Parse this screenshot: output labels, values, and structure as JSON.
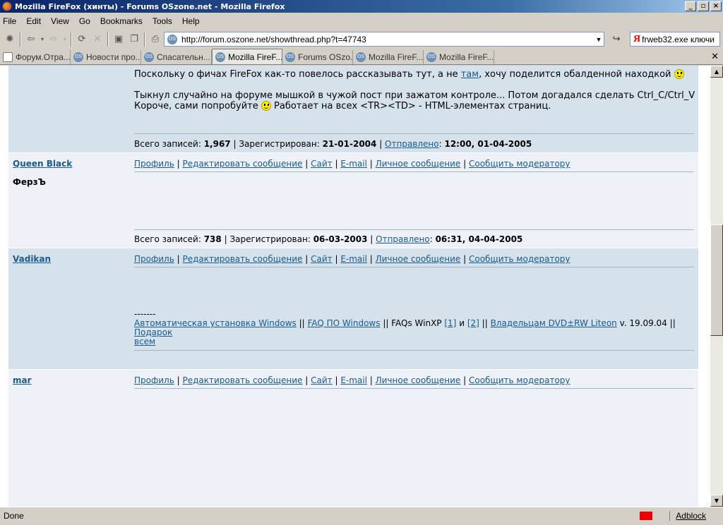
{
  "window": {
    "title": "Mozilla FireFox (хинты) - Forums OSzone.net - Mozilla Firefox"
  },
  "menu": [
    "File",
    "Edit",
    "View",
    "Go",
    "Bookmarks",
    "Tools",
    "Help"
  ],
  "address": {
    "url": "http://forum.oszone.net/showthread.php?t=47743",
    "search_value": "frweb32.exe ключи",
    "search_logo": "Я"
  },
  "tabs": [
    {
      "label": "Форум.Отра...",
      "icon": "page-icon"
    },
    {
      "label": "Новости про...",
      "icon": "os-icon"
    },
    {
      "label": "Спасательн...",
      "icon": "os-icon"
    },
    {
      "label": "Mozilla FireF...",
      "icon": "os-icon",
      "active": true
    },
    {
      "label": "Forums OSzo...",
      "icon": "os-icon"
    },
    {
      "label": "Mozilla FireF...",
      "icon": "os-icon"
    },
    {
      "label": "Mozilla FireF...",
      "icon": "os-icon"
    }
  ],
  "post1": {
    "line1_pre": "Поскольку о фичах FireFox как-то повелось рассказывать тут, а не ",
    "line1_link": "там",
    "line1_post": ", хочу поделится обалденной находкой",
    "line2": "Тыкнул случайно на форуме мышкой в чужой пост при зажатом контроле... Потом догадался сделать Ctrl_C/Ctrl_V",
    "line3_pre": "Короче, сами попробуйте",
    "line3_post": "Работает на всех <TR><TD> - HTML-элементах страниц.",
    "meta": {
      "posts_label": "Всего записей:",
      "posts": "1,967",
      "reg_label": "Зарегистрирован:",
      "reg": "21-01-2004",
      "sent_label": "Отправлено",
      "sent": "12:00, 01-04-2005"
    }
  },
  "links": {
    "profile": "Профиль",
    "edit": "Редактировать сообщение",
    "site": "Сайт",
    "email": "E-mail",
    "pm": "Личное сообщение",
    "report": "Сообщить модератору"
  },
  "post2": {
    "user": "Queen Black",
    "user_title": "ФерзЪ",
    "meta": {
      "posts_label": "Всего записей:",
      "posts": "738",
      "reg_label": "Зарегистрирован:",
      "reg": "06-03-2003",
      "sent_label": "Отправлено",
      "sent": "06:31, 04-04-2005"
    }
  },
  "post3": {
    "user": "Vadikan",
    "sig_dashes": "-------",
    "sig_link1": "Автоматическая установка Windows",
    "sig_sep1": "||",
    "sig_link2": "FAQ ПО Windows",
    "sig_sep2": "|| FAQs WinXP",
    "sig_link3": "[1]",
    "sig_and": "и",
    "sig_link4": "[2]",
    "sig_sep3": "||",
    "sig_link5": "Владельцам DVD±RW Liteon",
    "sig_ver": "v. 19.09.04 ||",
    "sig_link6a": "Подарок",
    "sig_link6b": "всем"
  },
  "post4": {
    "user": "mar"
  },
  "status": {
    "text": "Done",
    "adblock": "Adblock"
  }
}
